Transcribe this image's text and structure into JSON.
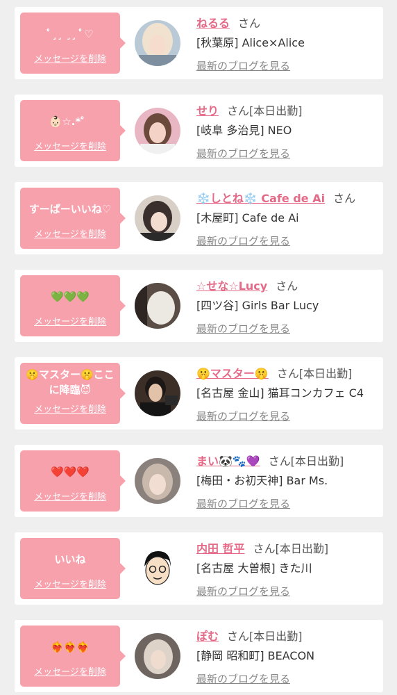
{
  "cards": [
    {
      "message": "ﾟ¸¸ ¸¸ ﾟ♡",
      "delete_label": "メッセージを削除",
      "name": "ねるる",
      "honorific": "さん",
      "status": "",
      "shop": "[秋葉原] Alice×Alice",
      "blog_link": "最新のブログを見る"
    },
    {
      "message": "👶🏻☆.*゜",
      "delete_label": "メッセージを削除",
      "name": "せり",
      "honorific": "さん",
      "status": "[本日出勤]",
      "shop": "[岐阜 多治見] NEO",
      "blog_link": "最新のブログを見る"
    },
    {
      "message": "すーぱーいいね♡",
      "delete_label": "メッセージを削除",
      "name": "❄️しとね❄️ Cafe de Ai",
      "honorific": "さん",
      "status": "",
      "shop": "[木屋町] Cafe de Ai",
      "blog_link": "最新のブログを見る"
    },
    {
      "message": "💚💚💚",
      "delete_label": "メッセージを削除",
      "name": "☆せな☆Lucy",
      "honorific": "さん",
      "status": "",
      "shop": "[四ツ谷] Girls Bar Lucy",
      "blog_link": "最新のブログを見る"
    },
    {
      "message": "🤫マスター🤫ここに降臨😈",
      "delete_label": "メッセージを削除",
      "name": "🤫マスター🤫",
      "honorific": "さん",
      "status": "[本日出勤]",
      "shop": "[名古屋 金山] 猫耳コンカフェ C4",
      "blog_link": "最新のブログを見る"
    },
    {
      "message": "❤️❤️❤️",
      "delete_label": "メッセージを削除",
      "name": "まい🐼🐾💜",
      "honorific": "さん",
      "status": "[本日出勤]",
      "shop": "[梅田・お初天神] Bar Ms.",
      "blog_link": "最新のブログを見る"
    },
    {
      "message": "いいね",
      "delete_label": "メッセージを削除",
      "name": "内田 哲平",
      "honorific": "さん",
      "status": "[本日出勤]",
      "shop": "[名古屋 大曽根] きた川",
      "blog_link": "最新のブログを見る"
    },
    {
      "message": "❤️‍🔥❤️‍🔥❤️‍🔥",
      "delete_label": "メッセージを削除",
      "name": "ぽむ",
      "honorific": "さん",
      "status": "[本日出勤]",
      "shop": "[静岡 昭和町] BEACON",
      "blog_link": "最新のブログを見る"
    }
  ],
  "avatars": [
    "avatar-photo-girl-1",
    "avatar-photo-girl-2",
    "avatar-photo-girl-3",
    "avatar-photo-girl-4",
    "avatar-photo-man-suit",
    "avatar-photo-girl-5",
    "avatar-illustration-man-glasses",
    "avatar-photo-girl-6"
  ],
  "colors": {
    "bubble": "#f7a1ad",
    "name": "#e46a87",
    "card": "#ffffff",
    "background": "#efefef"
  }
}
